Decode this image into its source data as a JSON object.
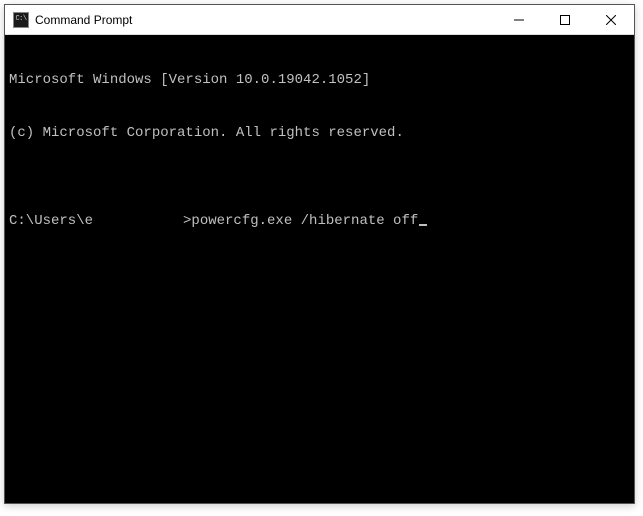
{
  "window": {
    "title": "Command Prompt",
    "icon_label": "C:\\"
  },
  "terminal": {
    "line1": "Microsoft Windows [Version 10.0.19042.1052]",
    "line2": "(c) Microsoft Corporation. All rights reserved.",
    "blank": "",
    "prompt_prefix": "C:\\Users\\e",
    "prompt_redacted": "",
    "prompt_suffix": ">",
    "command": "powercfg.exe /hibernate off"
  }
}
